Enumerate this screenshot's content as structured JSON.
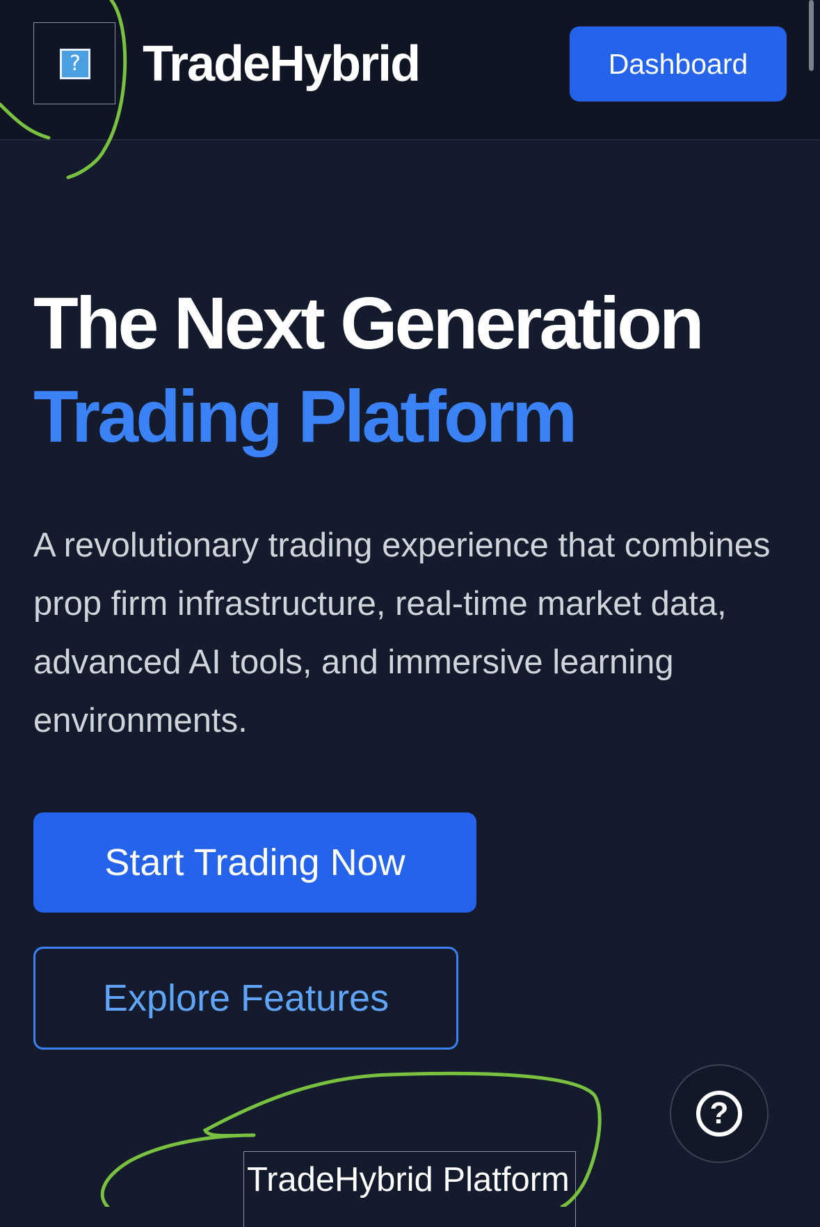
{
  "header": {
    "logo_glyph": "?",
    "brand": "TradeHybrid",
    "dashboard_label": "Dashboard"
  },
  "hero": {
    "title_line1": "The Next Generation",
    "title_line2": "Trading Platform",
    "description": "A revolutionary trading experience that combines prop firm infrastructure, real-time market data, advanced AI tools, and immersive learning environments.",
    "primary_cta": "Start Trading Now",
    "secondary_cta": "Explore Features"
  },
  "help": {
    "icon": "question-circle-icon",
    "glyph": "?"
  },
  "footer_image_alt": "TradeHybrid Platform",
  "colors": {
    "background": "#131b2c",
    "header": "#0f1522",
    "accent": "#2563eb",
    "accent_text": "#3b82f6",
    "annotation": "#7ac142"
  }
}
